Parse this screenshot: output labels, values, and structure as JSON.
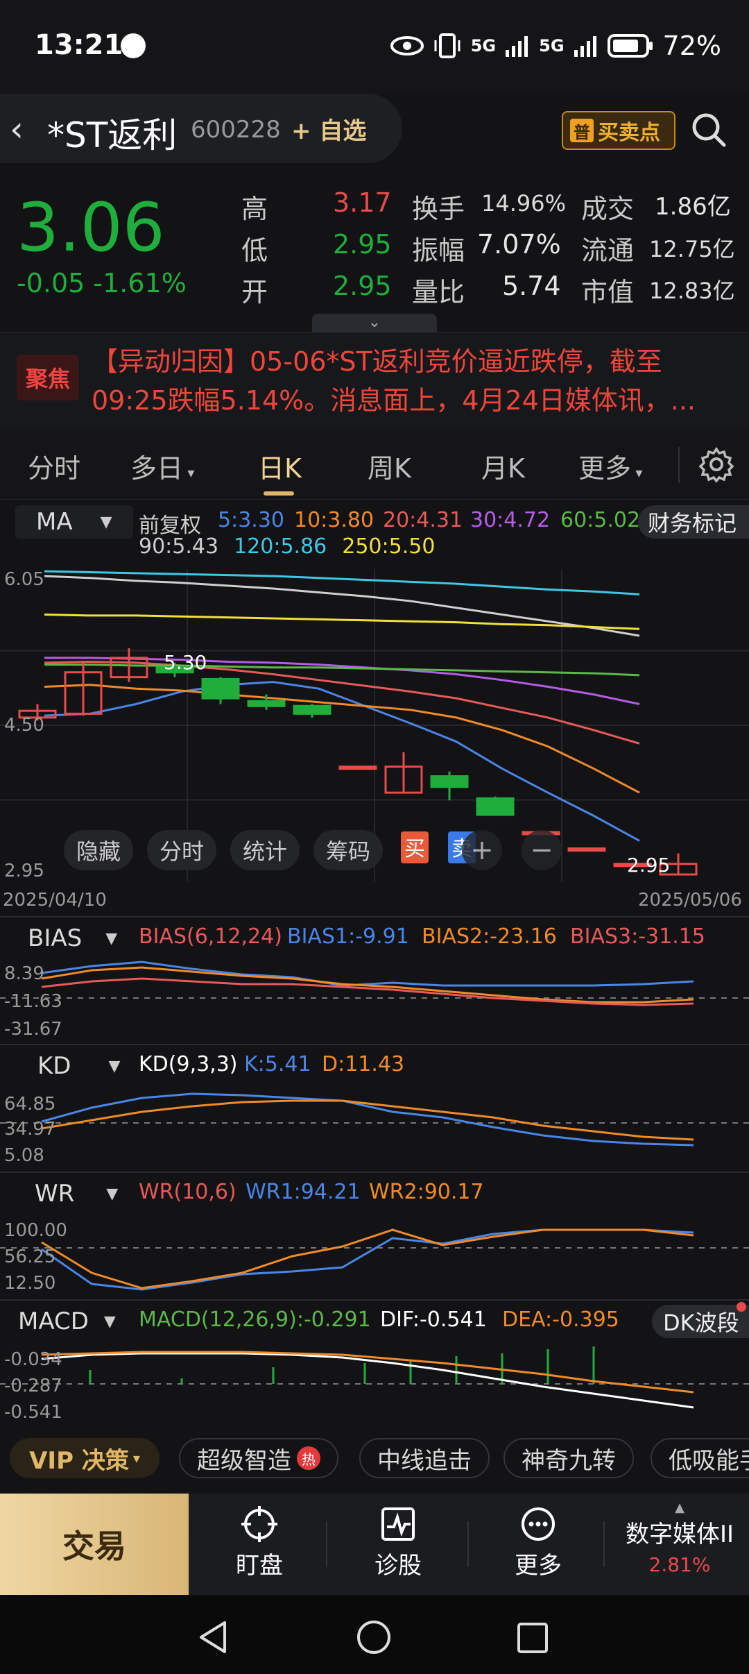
{
  "status_bar": {
    "time": "13:21",
    "battery": "72%",
    "signal1": "5G",
    "signal2": "5G"
  },
  "header": {
    "name": "*ST返利",
    "code": "600228",
    "add_watch": "+ 自选",
    "buy_sell_label": "买卖点",
    "buy_sell_badge": "普"
  },
  "quote": {
    "price": "3.06",
    "change": "-0.05 -1.61%",
    "high_label": "高",
    "high": "3.17",
    "low_label": "低",
    "low": "2.95",
    "open_label": "开",
    "open": "2.95",
    "turnover_label": "换手",
    "turnover": "14.96%",
    "amplitude_label": "振幅",
    "amplitude": "7.07%",
    "volume_ratio_label": "量比",
    "volume_ratio": "5.74",
    "amount_label": "成交",
    "amount": "1.86亿",
    "float_label": "流通",
    "float_cap": "12.75亿",
    "mktcap_label": "市值",
    "mktcap": "12.83亿"
  },
  "news": {
    "badge": "聚焦",
    "text": "【异动归因】05-06*ST返利竞价逼近跌停，截至09:25跌幅5.14%。消息面上，4月24日媒体讯，..."
  },
  "tabs": [
    "分时",
    "多日",
    "日K",
    "周K",
    "月K",
    "更多"
  ],
  "active_tab": "日K",
  "ma_legend": {
    "indicator": "MA",
    "adjust": "前复权",
    "items": [
      {
        "text": "5:3.30",
        "color": "#4a86e8"
      },
      {
        "text": "10:3.80",
        "color": "#f08a2a"
      },
      {
        "text": "20:4.31",
        "color": "#e85a5a"
      },
      {
        "text": "30:4.72",
        "color": "#b45ce8"
      },
      {
        "text": "60:5.02",
        "color": "#5cb84a"
      },
      {
        "text": "90:5.43",
        "color": "#cfcfcf"
      },
      {
        "text": "120:5.86",
        "color": "#3ec8e8"
      },
      {
        "text": "250:5.50",
        "color": "#f0e03a"
      }
    ],
    "finance_mark": "财务标记"
  },
  "chart_data": {
    "type": "candlestick",
    "x_range": [
      "2025/04/10",
      "2025/05/06"
    ],
    "y_ticks": [
      "6.05",
      "4.50",
      "2.95"
    ],
    "ylim": [
      2.95,
      6.05
    ],
    "annotations": {
      "high_label": "5.30",
      "low_label": "2.95",
      "buy": "买",
      "sell": "卖"
    },
    "candles": [
      {
        "o": 4.58,
        "c": 4.65,
        "h": 4.72,
        "l": 4.55
      },
      {
        "o": 4.62,
        "c": 5.05,
        "h": 5.15,
        "l": 4.6
      },
      {
        "o": 5.0,
        "c": 5.2,
        "h": 5.3,
        "l": 4.95
      },
      {
        "o": 5.1,
        "c": 5.05,
        "h": 5.15,
        "l": 5.0
      },
      {
        "o": 4.98,
        "c": 4.78,
        "h": 5.0,
        "l": 4.72
      },
      {
        "o": 4.75,
        "c": 4.7,
        "h": 4.82,
        "l": 4.66
      },
      {
        "o": 4.7,
        "c": 4.62,
        "h": 4.72,
        "l": 4.58
      },
      {
        "o": 4.07,
        "c": 4.07,
        "h": 4.07,
        "l": 4.07
      },
      {
        "o": 3.8,
        "c": 4.07,
        "h": 4.22,
        "l": 3.8
      },
      {
        "o": 3.97,
        "c": 3.86,
        "h": 4.02,
        "l": 3.72
      },
      {
        "o": 3.74,
        "c": 3.57,
        "h": 3.76,
        "l": 3.57
      },
      {
        "o": 3.39,
        "c": 3.39,
        "h": 3.39,
        "l": 3.39
      },
      {
        "o": 3.22,
        "c": 3.22,
        "h": 3.22,
        "l": 3.22
      },
      {
        "o": 3.06,
        "c": 3.06,
        "h": 3.06,
        "l": 3.06
      },
      {
        "o": 2.95,
        "c": 3.06,
        "h": 3.17,
        "l": 2.95
      }
    ],
    "ma_lines": [
      {
        "name": "MA5",
        "color": "#4a86e8",
        "values": [
          4.6,
          4.62,
          4.72,
          4.85,
          4.92,
          4.95,
          4.88,
          4.7,
          4.52,
          4.33,
          4.05,
          3.8,
          3.56,
          3.3
        ]
      },
      {
        "name": "MA10",
        "color": "#f08a2a",
        "values": [
          4.9,
          4.92,
          4.88,
          4.86,
          4.82,
          4.78,
          4.74,
          4.7,
          4.66,
          4.58,
          4.45,
          4.28,
          4.05,
          3.8
        ]
      },
      {
        "name": "MA20",
        "color": "#e85a5a",
        "values": [
          5.15,
          5.16,
          5.15,
          5.12,
          5.08,
          5.03,
          4.97,
          4.91,
          4.85,
          4.78,
          4.68,
          4.58,
          4.45,
          4.31
        ]
      },
      {
        "name": "MA30",
        "color": "#b45ce8",
        "values": [
          5.2,
          5.2,
          5.19,
          5.18,
          5.16,
          5.15,
          5.13,
          5.1,
          5.07,
          5.03,
          4.97,
          4.9,
          4.82,
          4.72
        ]
      },
      {
        "name": "MA60",
        "color": "#5cb84a",
        "values": [
          5.13,
          5.13,
          5.12,
          5.12,
          5.11,
          5.1,
          5.1,
          5.09,
          5.08,
          5.07,
          5.06,
          5.05,
          5.04,
          5.02
        ]
      },
      {
        "name": "MA90",
        "color": "#cfcfcf",
        "values": [
          6.05,
          6.03,
          6.0,
          5.98,
          5.95,
          5.92,
          5.88,
          5.84,
          5.79,
          5.72,
          5.65,
          5.58,
          5.51,
          5.43
        ]
      },
      {
        "name": "MA120",
        "color": "#3ec8e8",
        "values": [
          6.1,
          6.09,
          6.08,
          6.07,
          6.06,
          6.05,
          6.03,
          6.01,
          5.99,
          5.97,
          5.94,
          5.91,
          5.89,
          5.86
        ]
      },
      {
        "name": "MA250",
        "color": "#f0e03a",
        "values": [
          5.65,
          5.64,
          5.64,
          5.63,
          5.62,
          5.61,
          5.6,
          5.59,
          5.58,
          5.57,
          5.55,
          5.54,
          5.52,
          5.5
        ]
      }
    ]
  },
  "chart_toolbar": {
    "hide": "隐藏",
    "intraday": "分时",
    "stats": "统计",
    "chips": "筹码"
  },
  "bias": {
    "name": "BIAS",
    "legend": "BIAS(6,12,24)",
    "b1": "BIAS1:-9.91",
    "b2": "BIAS2:-23.16",
    "b3": "BIAS3:-31.15",
    "ticks": [
      "8.39",
      "-11.63",
      "-31.67"
    ]
  },
  "kd": {
    "name": "KD",
    "legend": "KD(9,3,3)",
    "k": "K:5.41",
    "d": "D:11.43",
    "ticks": [
      "64.85",
      "34.97",
      "5.08"
    ]
  },
  "wr": {
    "name": "WR",
    "legend": "WR(10,6)",
    "wr1": "WR1:94.21",
    "wr2": "WR2:90.17",
    "ticks": [
      "100.00",
      "56.25",
      "12.50"
    ]
  },
  "macd": {
    "name": "MACD",
    "legend": "MACD(12,26,9):-0.291",
    "dif": "DIF:-0.541",
    "dea": "DEA:-0.395",
    "ticks": [
      "-0.034",
      "-0.287",
      "-0.541"
    ],
    "dk": "DK波段"
  },
  "strategy": {
    "vip": "VIP 决策",
    "chips": [
      "超级智造",
      "中线追击",
      "神奇九转",
      "低吸能手"
    ],
    "hot": "热"
  },
  "bottom_nav": {
    "trade": "交易",
    "watch": "盯盘",
    "diagnose": "诊股",
    "more": "更多",
    "sector_name": "数字媒体II",
    "sector_change": "2.81%"
  }
}
